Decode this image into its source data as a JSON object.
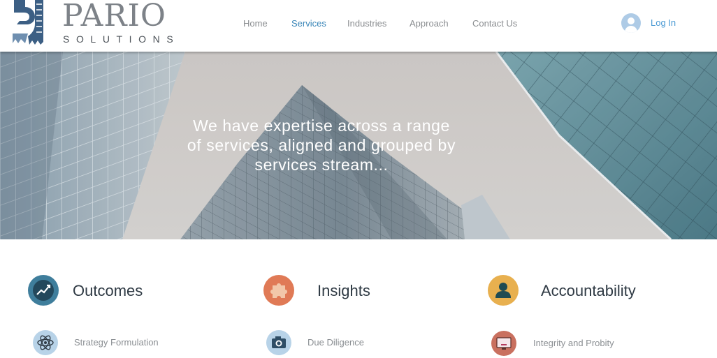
{
  "header": {
    "logo": {
      "word": "PARIO",
      "sub": "SOLUTIONS"
    },
    "nav": [
      {
        "label": "Home",
        "active": false
      },
      {
        "label": "Services",
        "active": true
      },
      {
        "label": "Industries",
        "active": false
      },
      {
        "label": "Approach",
        "active": false
      },
      {
        "label": "Contact Us",
        "active": false
      }
    ],
    "login": {
      "label": "Log In",
      "icon": "user-avatar-icon"
    }
  },
  "hero": {
    "lines": [
      "We have expertise across a range",
      "of services, aligned and grouped by",
      "services stream..."
    ]
  },
  "columns": [
    {
      "title": "Outcomes",
      "icon": "trend-chart-icon",
      "icon_color": "#3f7e9c",
      "service": {
        "label": "Strategy Formulation",
        "icon": "atom-icon",
        "icon_color": "#b8d3e8"
      }
    },
    {
      "title": "Insights",
      "icon": "puzzle-icon",
      "icon_color": "#e07a56",
      "service": {
        "label": "Due Diligence",
        "icon": "camera-icon",
        "icon_color": "#b8d3e8"
      }
    },
    {
      "title": "Accountability",
      "icon": "person-icon",
      "icon_color": "#e8b04f",
      "service": {
        "label": "Integrity and Probity",
        "icon": "monitor-icon",
        "icon_color": "#c9705f"
      }
    }
  ],
  "colors": {
    "nav_active": "#3a86b8",
    "login": "#4a9ad4",
    "text_dark": "#2f3a44",
    "text_muted": "#8b8f93"
  }
}
